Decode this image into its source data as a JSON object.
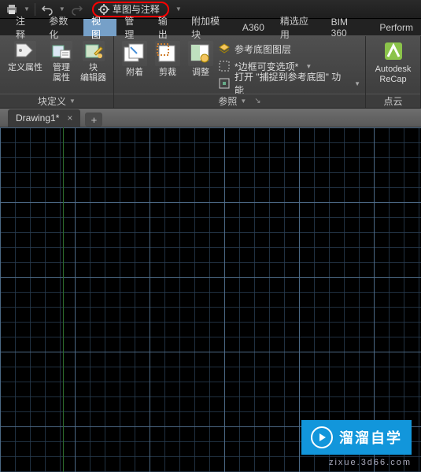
{
  "qat": {
    "workspace_label": "草图与注释"
  },
  "menutabs": {
    "items": [
      {
        "label": "注释"
      },
      {
        "label": "参数化"
      },
      {
        "label": "视图"
      },
      {
        "label": "管理"
      },
      {
        "label": "输出"
      },
      {
        "label": "附加模块"
      },
      {
        "label": "A360"
      },
      {
        "label": "精选应用"
      },
      {
        "label": "BIM 360"
      },
      {
        "label": "Perform"
      }
    ],
    "selected_index": 2
  },
  "ribbon": {
    "panel_block": {
      "title": "块定义",
      "define_attr": "定义属性",
      "manage_attr": "管理\n属性",
      "block_editor": "块\n编辑器"
    },
    "panel_ref": {
      "title": "参照",
      "attach": "附着",
      "clip": "剪裁",
      "adjust": "调整",
      "row_layers": "参考底图图层",
      "row_frames": "*边框可变选项*",
      "row_snap": "打开 \"捕捉到参考底图\" 功能"
    },
    "panel_recap": {
      "title": "点云",
      "label": "Autodesk\nReCap"
    }
  },
  "doctab": {
    "name": "Drawing1*"
  },
  "watermark": {
    "brand": "溜溜自学",
    "url": "zixue.3d66.com"
  }
}
